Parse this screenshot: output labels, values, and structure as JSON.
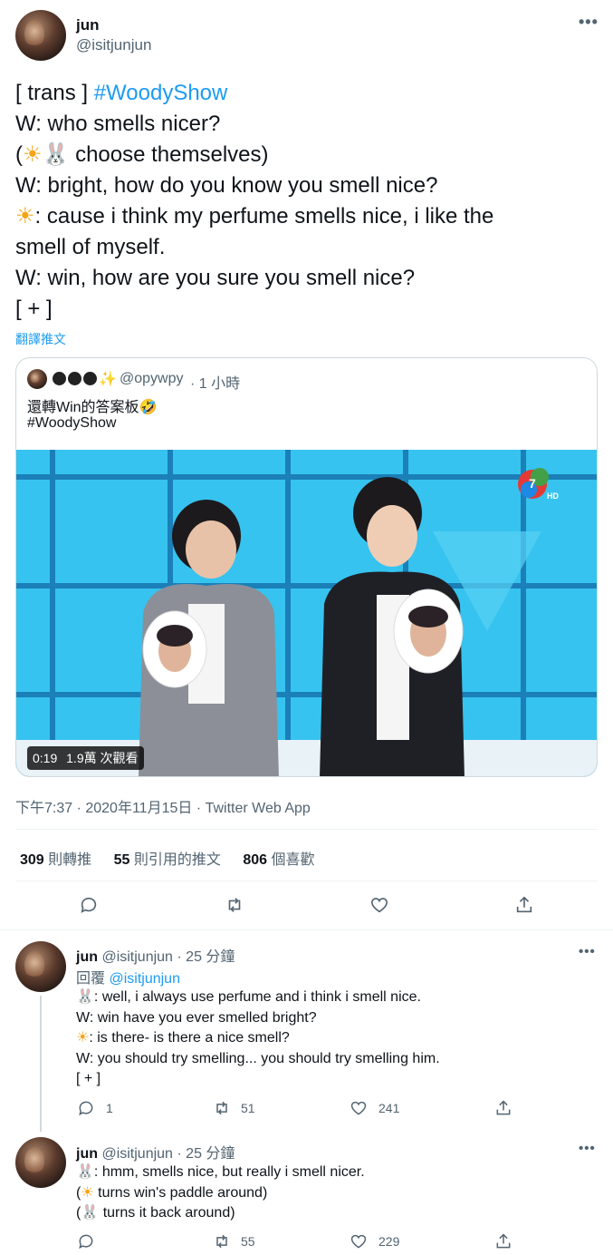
{
  "tweet": {
    "name": "jun",
    "handle": "@isitjunjun",
    "lines": {
      "l1_prefix": "[ trans ] ",
      "l1_hashtag": "#WoodyShow",
      "l2": "W: who smells nicer?",
      "l3_open": "(",
      "l3_rest": " choose themselves)",
      "l4": "W: bright, how do you know you smell nice?",
      "l5": ": cause i think my perfume smells nice, i like the",
      "l6": "smell of myself.",
      "l7": "W: win, how are you sure you smell nice?",
      "l8": "[ + ]"
    },
    "translate": "翻譯推文",
    "timestamp": "下午7:37 · 2020年11月15日 · Twitter Web App",
    "stats": {
      "retweets_num": "309",
      "retweets_label": "則轉推",
      "quotes_num": "55",
      "quotes_label": "則引用的推文",
      "likes_num": "806",
      "likes_label": "個喜歡"
    }
  },
  "quoted": {
    "name_emoji": "ᅌᅌᅌ✨",
    "handle": "@opywpy",
    "time": "· 1 小時",
    "line1": "還轉Win的答案板🤣",
    "line2": "#WoodyShow",
    "video_time": "0:19",
    "video_views": "1.9萬 次觀看"
  },
  "replies": [
    {
      "name": "jun",
      "handle": "@isitjunjun",
      "time": "· 25 分鐘",
      "reply_to_label": "回覆",
      "reply_to_handle": "@isitjunjun",
      "l1": ": well, i always use perfume and i think i smell nice.",
      "l2": "W: win have you ever smelled bright?",
      "l3": ": is there- is there a nice smell?",
      "l4": "W: you should try smelling... you should try smelling him.",
      "l5": "[ + ]",
      "replies_count": "1",
      "retweets_count": "51",
      "likes_count": "241"
    },
    {
      "name": "jun",
      "handle": "@isitjunjun",
      "time": "· 25 分鐘",
      "l1": ": hmm, smells nice, but really i smell nicer.",
      "l2_open": "(",
      "l2": " turns win's paddle around)",
      "l3_open": "(",
      "l3": " turns it back around)",
      "replies_count": "",
      "retweets_count": "55",
      "likes_count": "229"
    }
  ],
  "icons": {
    "more": "more-dots-icon",
    "reply": "reply-bubble-icon",
    "retweet": "retweet-icon",
    "like": "heart-icon",
    "share": "share-icon",
    "sun": "sun-emoji",
    "rabbit": "rabbit-emoji",
    "laugh": "rolling-laugh-emoji"
  },
  "colors": {
    "link": "#1d9bf0",
    "muted": "#536471",
    "text": "#0f1419",
    "divider": "#eff3f4",
    "video_bg": "#2bb7e8"
  }
}
